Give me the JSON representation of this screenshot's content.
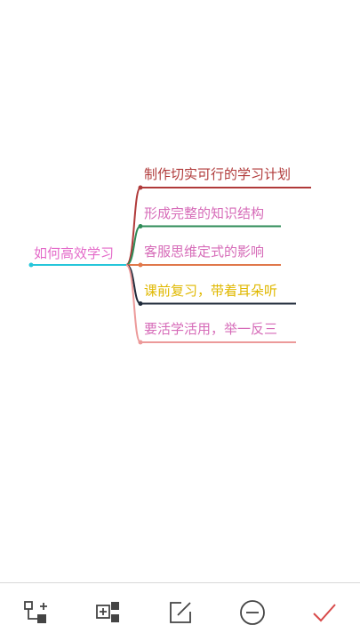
{
  "mindmap": {
    "root": {
      "label": "如何高效学习",
      "color": "#e46ac9",
      "line_color": "#26c6da"
    },
    "branches": [
      {
        "label": "制作切实可行的学习计划",
        "color": "#b03a3a",
        "line_color": "#b03a3a"
      },
      {
        "label": "形成完整的知识结构",
        "color": "#d66bb8",
        "line_color": "#2e8b57"
      },
      {
        "label": "客服思维定式的影响",
        "color": "#d66bb8",
        "line_color": "#e0784a"
      },
      {
        "label": "课前复习，带着耳朵听",
        "color": "#e0b800",
        "line_color": "#1f2a3a"
      },
      {
        "label": "要活学活用，举一反三",
        "color": "#d66bb8",
        "line_color": "#ec9a9a"
      }
    ]
  },
  "toolbar": {
    "buttons": [
      {
        "icon": "add-child-node-icon"
      },
      {
        "icon": "add-sibling-node-icon"
      },
      {
        "icon": "edit-icon"
      },
      {
        "icon": "delete-icon"
      },
      {
        "icon": "confirm-check-icon"
      }
    ],
    "confirm_color": "#d84a4a"
  }
}
